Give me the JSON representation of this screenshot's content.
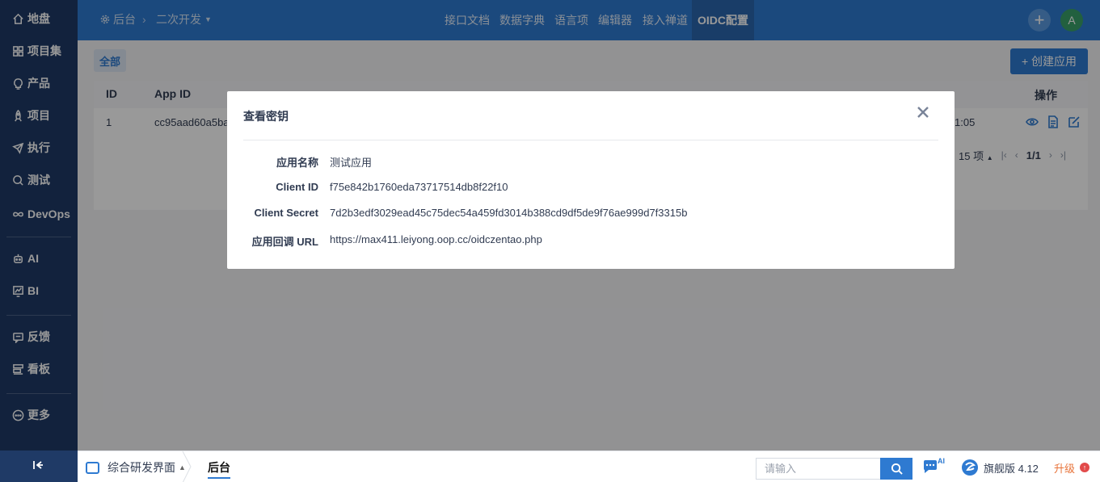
{
  "sidebar": {
    "items": [
      {
        "label": "地盘",
        "icon": "home-icon"
      },
      {
        "label": "项目集",
        "icon": "grid-icon"
      },
      {
        "label": "产品",
        "icon": "lightbulb-icon"
      },
      {
        "label": "项目",
        "icon": "rocket-icon"
      },
      {
        "label": "执行",
        "icon": "launch-icon"
      },
      {
        "label": "测试",
        "icon": "bug-search-icon"
      },
      {
        "label": "DevOps",
        "icon": "infinity-icon"
      },
      {
        "label": "AI",
        "icon": "robot-icon"
      },
      {
        "label": "BI",
        "icon": "chart-icon"
      },
      {
        "label": "反馈",
        "icon": "feedback-icon"
      },
      {
        "label": "看板",
        "icon": "kanban-icon"
      },
      {
        "label": "更多",
        "icon": "more-icon"
      }
    ]
  },
  "header": {
    "breadcrumb": {
      "home": "后台",
      "current": "二次开发"
    },
    "nav": [
      "接口文档",
      "数据字典",
      "语言项",
      "编辑器",
      "接入禅道",
      "OIDC配置"
    ],
    "active_nav": "OIDC配置",
    "avatar_letter": "A",
    "plus_label": "+"
  },
  "content": {
    "filter_all": "全部",
    "create_label": "+ 创建应用",
    "table": {
      "headers": [
        "ID",
        "App ID",
        "操作"
      ],
      "row": {
        "id": "1",
        "app_id": "cc95aad60a5ba",
        "time_tail": "1:05"
      }
    },
    "pager": {
      "per_page": "15 项",
      "page": "1/1",
      "first": "|‹",
      "prev": "‹",
      "next": "›",
      "last": "›|"
    }
  },
  "modal": {
    "title": "查看密钥",
    "close": "×",
    "fields": [
      {
        "label": "应用名称",
        "value": "测试应用"
      },
      {
        "label": "Client ID",
        "value": "f75e842b1760eda73717514db8f22f10"
      },
      {
        "label": "Client Secret",
        "value": "7d2b3edf3029ead45c75dec54a459fd3014b388cd9df5de9f76ae999d7f3315b"
      },
      {
        "label": "应用回调 URL",
        "value": "https://max411.leiyong.oop.cc/oidczentao.php"
      }
    ]
  },
  "footer": {
    "app_switch": "综合研发界面",
    "tab": "后台",
    "search_placeholder": "请输入",
    "ai_badge": "AI",
    "edition": "旗舰版 4.12",
    "upgrade": "升级",
    "upgrade_mark": "↑"
  },
  "colors": {
    "sidebar_bg": "#1f3a66",
    "header_bg": "#2e7ad1",
    "accent": "#2e7ad1",
    "upgrade": "#e8743b"
  }
}
